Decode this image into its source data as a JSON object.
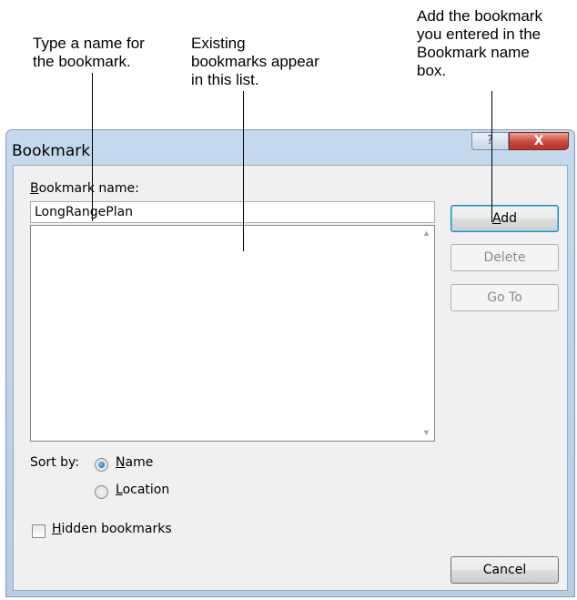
{
  "callouts": {
    "name": [
      "Type a name for",
      "the bookmark."
    ],
    "list": [
      "Existing",
      "bookmarks appear",
      "in this list."
    ],
    "add": [
      "Add the bookmark",
      "you entered in the",
      "Bookmark name",
      "box."
    ]
  },
  "dialog": {
    "title": "Bookmark",
    "help_glyph": "?",
    "close_glyph": "X"
  },
  "form": {
    "name_label_ak": "B",
    "name_label_rest": "ookmark name:",
    "name_value": "LongRangePlan",
    "sort_label": "Sort by:",
    "sort_options": [
      {
        "ak": "N",
        "rest": "ame",
        "checked": true
      },
      {
        "ak": "L",
        "rest": "ocation",
        "checked": false
      }
    ],
    "hidden_ak": "H",
    "hidden_rest": "idden bookmarks",
    "hidden_checked": false
  },
  "buttons": {
    "add_ak": "A",
    "add_rest": "dd",
    "delete": "Delete",
    "goto": "Go To",
    "cancel": "Cancel"
  },
  "icons": {
    "scroll_up": "▲",
    "scroll_down": "▼"
  }
}
